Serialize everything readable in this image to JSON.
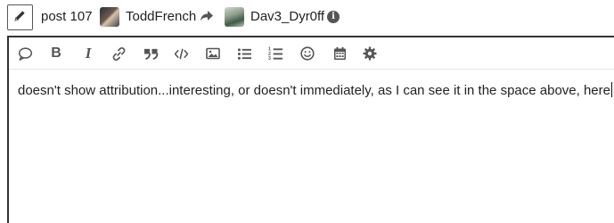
{
  "header": {
    "post_label": "post 107",
    "reply_from_user": "ToddFrench",
    "reply_to_user": "Dav3_Dyr0ff",
    "icons": {
      "edit": "pencil-icon",
      "reply": "reply-arrow-icon",
      "info": "info-icon"
    }
  },
  "toolbar": {
    "buttons": [
      {
        "name": "quote-bubble-icon",
        "label": ""
      },
      {
        "name": "bold-button",
        "label": "B"
      },
      {
        "name": "italic-button",
        "label": "I"
      },
      {
        "name": "link-icon",
        "label": ""
      },
      {
        "name": "blockquote-icon",
        "label": ""
      },
      {
        "name": "code-icon",
        "label": ""
      },
      {
        "name": "image-icon",
        "label": ""
      },
      {
        "name": "bullet-list-icon",
        "label": ""
      },
      {
        "name": "numbered-list-icon",
        "label": ""
      },
      {
        "name": "emoji-icon",
        "label": ""
      },
      {
        "name": "calendar-icon",
        "label": ""
      },
      {
        "name": "gear-icon",
        "label": ""
      }
    ]
  },
  "editor": {
    "text": "doesn't show attribution...interesting, or doesn't immediately, as I can see it in the space above, here"
  },
  "colors": {
    "text": "#222222",
    "icon": "#555555",
    "border": "#333333",
    "toolbar_divider": "#e4e4e4"
  }
}
